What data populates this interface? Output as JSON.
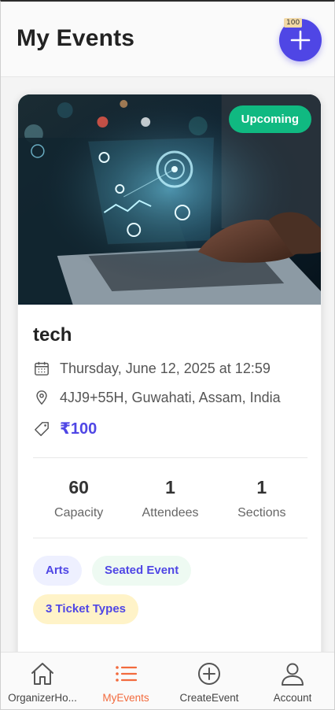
{
  "header": {
    "title": "My Events",
    "add_icon": "plus-icon",
    "debug_badge": "100"
  },
  "event": {
    "status": "Upcoming",
    "title": "tech",
    "date": "Thursday, June 12, 2025 at 12:59",
    "location": "4JJ9+55H, Guwahati, Assam, India",
    "price": "₹100",
    "stats": [
      {
        "value": "60",
        "label": "Capacity"
      },
      {
        "value": "1",
        "label": "Attendees"
      },
      {
        "value": "1",
        "label": "Sections"
      }
    ],
    "tags": [
      "Arts",
      "Seated Event",
      "3 Ticket Types"
    ]
  },
  "nav": {
    "items": [
      {
        "label": "OrganizerHo...",
        "icon": "home-icon",
        "active": false
      },
      {
        "label": "MyEvents",
        "icon": "list-icon",
        "active": true
      },
      {
        "label": "CreateEvent",
        "icon": "plus-circle-icon",
        "active": false
      },
      {
        "label": "Account",
        "icon": "user-icon",
        "active": false
      }
    ]
  },
  "colors": {
    "accent": "#4f46e5",
    "status_green": "#10b981",
    "nav_active": "#f26a3d"
  }
}
